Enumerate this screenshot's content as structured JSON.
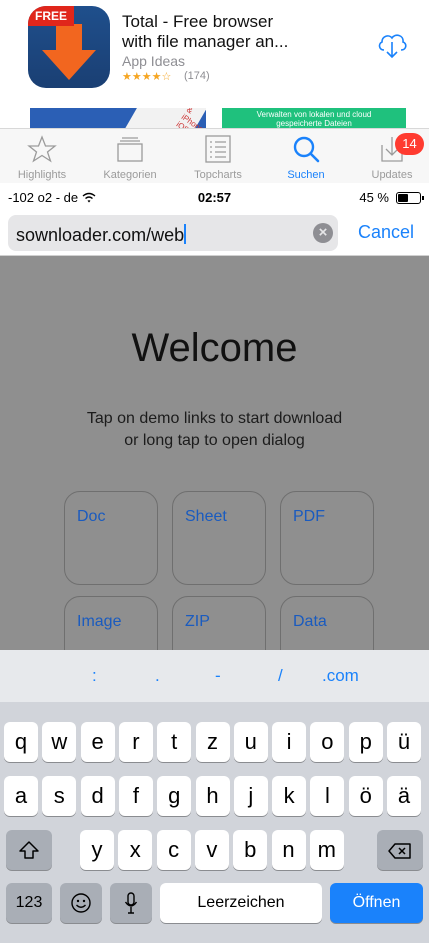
{
  "app": {
    "badge_text": "FREE",
    "title_line1": "Total - Free browser",
    "title_line2": "with file manager an...",
    "developer": "App Ideas",
    "stars": "★★★★☆",
    "rating_count": "(174)",
    "banner_ios": "& iPhone iOS",
    "banner_text_line1": "Verwalten von lokalen und cloud",
    "banner_text_line2": "gespeicherte Dateien"
  },
  "tabbar": {
    "tabs": [
      {
        "label": "Highlights",
        "icon": "star-icon"
      },
      {
        "label": "Kategorien",
        "icon": "categories-icon"
      },
      {
        "label": "Topcharts",
        "icon": "list-icon"
      },
      {
        "label": "Suchen",
        "icon": "search-icon"
      },
      {
        "label": "Updates",
        "icon": "updates-icon"
      }
    ],
    "active": "Suchen",
    "updates_badge": "14"
  },
  "status": {
    "carrier": "-102 o2 - de",
    "time": "02:57",
    "battery": "45 %"
  },
  "urlbar": {
    "value": "sownloader.com/web",
    "cancel": "Cancel"
  },
  "web": {
    "welcome": "Welcome",
    "line1": "Tap on demo links to start download",
    "line2": "or long tap to open dialog",
    "links": [
      "Doc",
      "Sheet",
      "PDF",
      "Image",
      "ZIP",
      "Data"
    ]
  },
  "keyboard": {
    "suggestions": [
      ":",
      ".",
      "-",
      "/",
      ".com"
    ],
    "row1": [
      "q",
      "w",
      "e",
      "r",
      "t",
      "z",
      "u",
      "i",
      "o",
      "p",
      "ü"
    ],
    "row2": [
      "a",
      "s",
      "d",
      "f",
      "g",
      "h",
      "j",
      "k",
      "l",
      "ö",
      "ä"
    ],
    "row3": [
      "y",
      "x",
      "c",
      "v",
      "b",
      "n",
      "m"
    ],
    "numbers_key": "123",
    "space_key": "Leerzeichen",
    "return_key": "Öffnen"
  },
  "colors": {
    "accent": "#1a82fb",
    "badge": "#ff3b30",
    "web_bg": "#8f8f8f",
    "keyboard_bg": "#d1d4da"
  }
}
